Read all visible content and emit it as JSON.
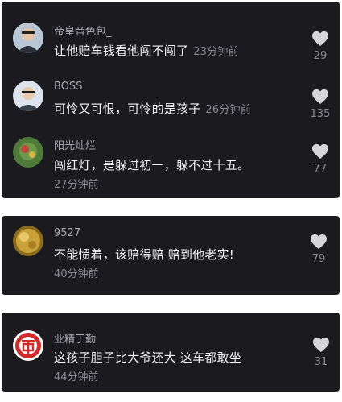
{
  "colors": {
    "card_bg": "#1b1b1f",
    "username": "#a9a9b0",
    "comment_text": "#f2f2f2",
    "meta": "#8a8a91",
    "heart": "#d6d6d9"
  },
  "cards": [
    {
      "comments": [
        {
          "avatar": "person-avatar",
          "username": "帝皇音色包_",
          "text": "让他赔车钱看他闯不闯了",
          "time": "23分钟前",
          "likes": "29"
        },
        {
          "avatar": "person-avatar",
          "username": "BOSS",
          "text": "可怜又可恨，可怜的是孩子",
          "time": "26分钟前",
          "likes": "135"
        },
        {
          "avatar": "nature-avatar",
          "username": "阳光灿烂",
          "text": "闯红灯，是躲过初一，躲不过十五。",
          "time": "27分钟前",
          "likes": "77"
        }
      ]
    },
    {
      "comments": [
        {
          "avatar": "gold-avatar",
          "username": "9527",
          "text": "不能惯着，该赔得赔 赔到他老实!",
          "time": "40分钟前",
          "likes": "79"
        }
      ]
    },
    {
      "comments": [
        {
          "avatar": "logo-avatar",
          "username": "业精于勤",
          "text": "这孩子胆子比大爷还大 这车都敢坐",
          "time": "44分钟前",
          "likes": "31"
        }
      ]
    }
  ]
}
